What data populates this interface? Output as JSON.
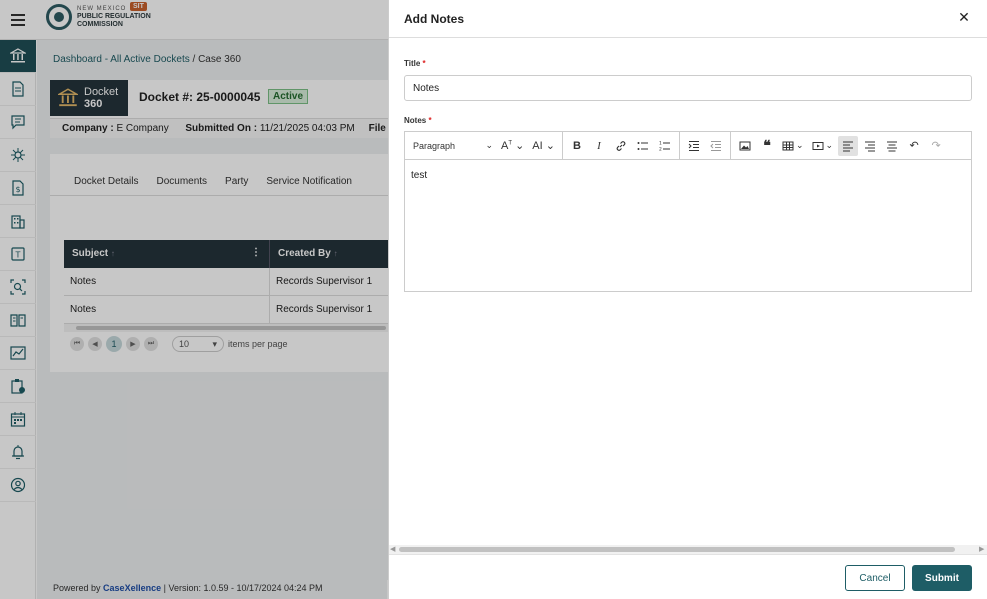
{
  "app": {
    "logo": {
      "line1": "NEW MEXICO",
      "line2": "PUBLIC REGULATION",
      "line3": "COMMISSION"
    },
    "env_badge": "SIT"
  },
  "sidebar": {
    "items": [
      {
        "icon": "bank-icon",
        "active": true
      },
      {
        "icon": "document-icon"
      },
      {
        "icon": "chat-icon"
      },
      {
        "icon": "network-icon"
      },
      {
        "icon": "dollar-document-icon"
      },
      {
        "icon": "building-icon"
      },
      {
        "icon": "text-document-icon"
      },
      {
        "icon": "search-user-icon"
      },
      {
        "icon": "book-icon"
      },
      {
        "icon": "chart-icon"
      },
      {
        "icon": "clipboard-icon"
      },
      {
        "icon": "calendar-icon"
      },
      {
        "icon": "alarm-icon"
      },
      {
        "icon": "user-circle-icon"
      }
    ]
  },
  "breadcrumb": {
    "link": "Dashboard - All Active Dockets",
    "separator": " / ",
    "current": "Case 360"
  },
  "docket": {
    "logo_line1": "Docket",
    "logo_line2": "360",
    "number": "Docket #: 25-0000045",
    "status": "Active",
    "company_label": "Company :",
    "company_value": "E Company",
    "submitted_label": "Submitted On :",
    "submitted_value": "11/21/2025 04:03 PM",
    "filed_label": "File"
  },
  "tabs": [
    "Docket Details",
    "Documents",
    "Party",
    "Service Notification"
  ],
  "grid": {
    "columns": [
      "Subject",
      "Created By"
    ],
    "rows": [
      {
        "subject": "Notes",
        "created_by": "Records Supervisor 1"
      },
      {
        "subject": "Notes",
        "created_by": "Records Supervisor 1"
      }
    ],
    "pager": {
      "current_page": "1",
      "page_size": "10",
      "items_per_page_label": "items per page"
    }
  },
  "footer": {
    "powered_by": "Powered by",
    "brand": "CaseXellence",
    "version": "|  Version: 1.0.59 - 10/17/2024 04:24 PM"
  },
  "modal": {
    "title": "Add Notes",
    "title_field": {
      "label": "Title",
      "value": "Notes"
    },
    "notes_field": {
      "label": "Notes",
      "content": "test"
    },
    "editor": {
      "paragraph_select": "Paragraph"
    },
    "cancel_label": "Cancel",
    "submit_label": "Submit"
  },
  "colors": {
    "primary": "#1e5d66",
    "header_dark": "#24343b",
    "active_badge": "#d9efdc",
    "env_badge": "#c8612c"
  }
}
